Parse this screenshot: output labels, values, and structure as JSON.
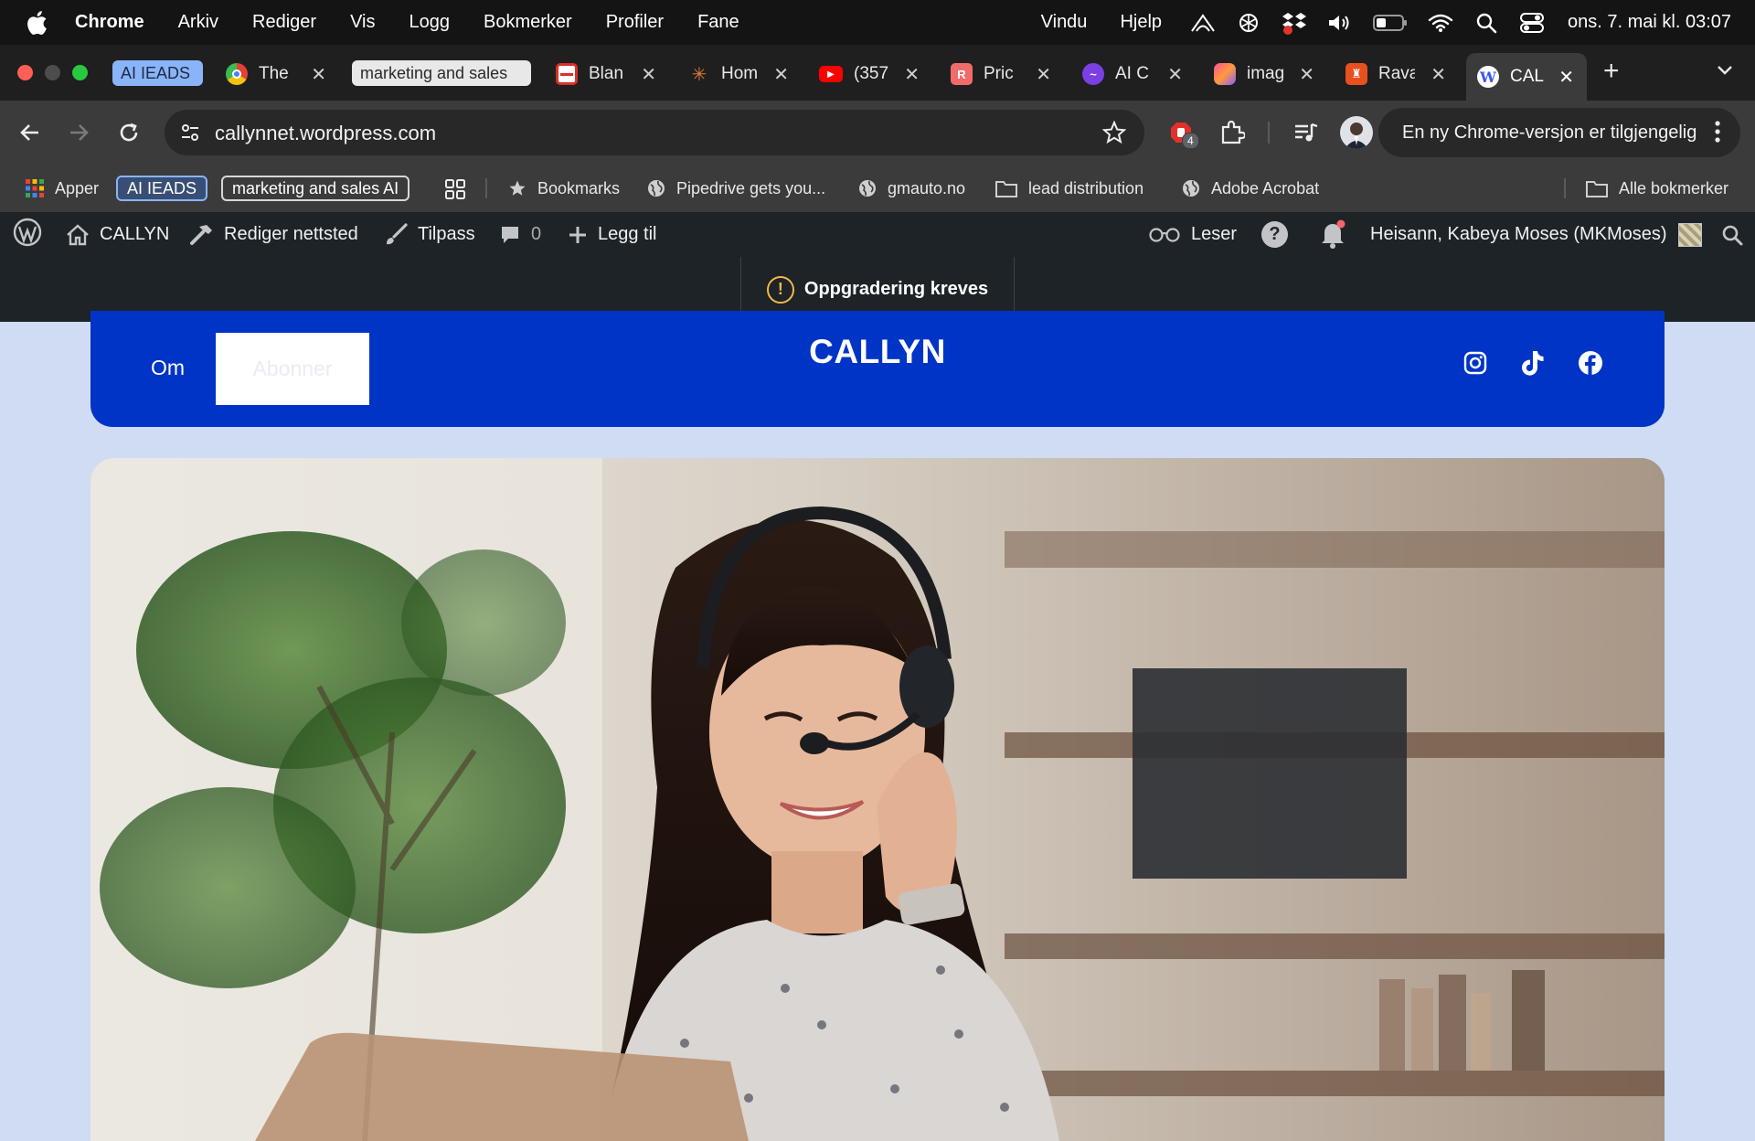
{
  "menubar": {
    "app_name": "Chrome",
    "items": [
      "Arkiv",
      "Rediger",
      "Vis",
      "Logg",
      "Bokmerker",
      "Profiler",
      "Fane"
    ],
    "right_items": [
      "Vindu",
      "Hjelp"
    ],
    "clock": "ons. 7. mai kl. 03:07"
  },
  "tabs": {
    "group1_label": "AI IEADS",
    "group2_label": "marketing and sales",
    "items": [
      {
        "title": "The",
        "icon": "chrome-icon"
      },
      {
        "title": "Blan",
        "icon": "blank-icon"
      },
      {
        "title": "Hom",
        "icon": "claude-icon"
      },
      {
        "title": "(357",
        "icon": "youtube-icon"
      },
      {
        "title": "Pric",
        "icon": "pricing-icon"
      },
      {
        "title": "AI C",
        "icon": "ai-icon"
      },
      {
        "title": "imag",
        "icon": "image-icon"
      },
      {
        "title": "Rava",
        "icon": "rava-icon"
      },
      {
        "title": "CAL",
        "icon": "wordpress-icon"
      }
    ],
    "active_index": 8
  },
  "toolbar": {
    "url": "callynnet.wordpress.com",
    "extension_badge": "4",
    "update_message": "En ny Chrome-versjon er tilgjengelig"
  },
  "bookmarks": {
    "apps": "Apper",
    "group1": "AI IEADS",
    "group2": "marketing and sales AI",
    "items": [
      "Bookmarks",
      "Pipedrive gets you...",
      "gmauto.no",
      "lead distribution",
      "Adobe Acrobat"
    ],
    "all": "Alle bokmerker"
  },
  "wpbar": {
    "site": "CALLYN",
    "edit_site": "Rediger nettsted",
    "customize": "Tilpass",
    "comments": "0",
    "add_new": "Legg til",
    "reader": "Leser",
    "greeting": "Heisann, Kabeya Moses (MKMoses)"
  },
  "notice": {
    "text": "Oppgradering kreves",
    "icon": "!"
  },
  "site": {
    "title": "CALLYN",
    "nav_about": "Om",
    "nav_subscribe": "Abonner",
    "social_icons": [
      "instagram-icon",
      "tiktok-icon",
      "facebook-icon"
    ],
    "hero_alt": "Woman with headset working at laptop"
  },
  "colors": {
    "header_blue": "#0034c7",
    "page_bg": "#cfdcf4",
    "wp_bar": "#1d2327",
    "group_blue": "#8ab4f8",
    "warning": "#f0b849"
  }
}
